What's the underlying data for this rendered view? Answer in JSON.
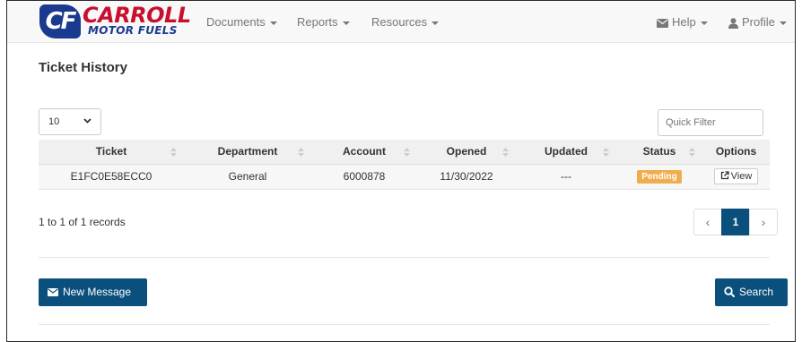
{
  "brand": {
    "logo_mark": "CF",
    "name": "CARROLL",
    "sub": "MOTOR FUELS"
  },
  "nav": {
    "documents": "Documents",
    "reports": "Reports",
    "resources": "Resources",
    "help": "Help",
    "profile": "Profile"
  },
  "page": {
    "title": "Ticket History"
  },
  "controls": {
    "page_length": "10",
    "quick_filter_placeholder": "Quick Filter"
  },
  "table": {
    "headers": [
      "Ticket",
      "Department",
      "Account",
      "Opened",
      "Updated",
      "Status",
      "Options"
    ],
    "rows": [
      {
        "ticket": "E1FC0E58ECC0",
        "department": "General",
        "account": "6000878",
        "opened": "11/30/2022",
        "updated": "---",
        "status": "Pending",
        "option": "View"
      }
    ]
  },
  "pagination": {
    "summary": "1 to 1 of 1 records",
    "prev": "‹",
    "current": "1",
    "next": "›"
  },
  "actions": {
    "new_message": "New Message",
    "search": "Search"
  },
  "colors": {
    "primary": "#0b4f7c",
    "status_pending": "#f0ad4e",
    "brand_red": "#c8102e",
    "brand_blue": "#1a3a8f"
  }
}
